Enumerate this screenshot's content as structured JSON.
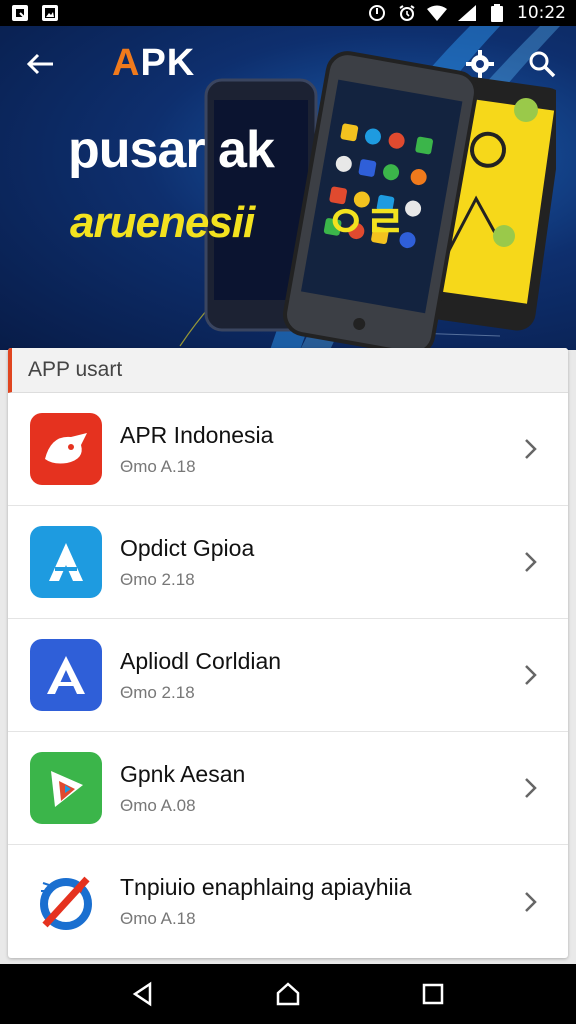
{
  "status_bar": {
    "time": "10:22"
  },
  "header": {
    "brand": "APK",
    "brand_accent": "A",
    "brand_rest": "PK",
    "headline_line1": "pusar ak",
    "headline_line2": "aruenesii",
    "headline_suffix": "ㅇㄹ"
  },
  "list": {
    "section_title": "APP usart",
    "items": [
      {
        "title": "APR Indonesia",
        "subtitle": "Θmo A.18",
        "icon": "red-fox-icon",
        "color": "#e5321f"
      },
      {
        "title": "Opdict Gpioa",
        "subtitle": "Θmo 2.18",
        "icon": "blue-a-icon",
        "color": "#1e9be0"
      },
      {
        "title": "Apliodl Corldian",
        "subtitle": "Θmo 2.18",
        "icon": "app-store-a-icon",
        "color": "#2f5fd8"
      },
      {
        "title": "Gpnk Aesan",
        "subtitle": "Θmo A.08",
        "icon": "green-play-icon",
        "color": "#3bb54a"
      },
      {
        "title": "Tnpiuio enaphlaing apiayhiia",
        "subtitle": "Θmo A.18",
        "icon": "rocket-icon",
        "color": "#1a6fd0"
      }
    ]
  },
  "colors": {
    "accent": "#e0451f",
    "hero_bg": "#0e2f6e",
    "headline_yellow": "#f3e21f"
  }
}
